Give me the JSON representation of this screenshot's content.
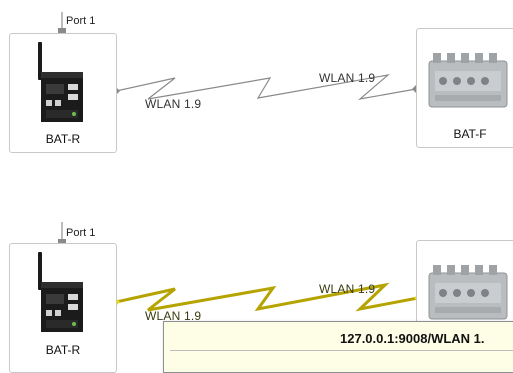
{
  "diagram": {
    "top": {
      "left_device": {
        "label": "BAT-R",
        "port_label": "Port 1"
      },
      "right_device": {
        "label": "BAT-F"
      },
      "link": {
        "label_left": "WLAN 1.9",
        "label_right": "WLAN 1.9",
        "color": "#8a8a8a"
      }
    },
    "bottom": {
      "left_device": {
        "label": "BAT-R",
        "port_label": "Port 1"
      },
      "link": {
        "label_left": "WLAN 1.9",
        "label_right": "WLAN 1.9",
        "color": "#b5a400",
        "selected": true
      }
    }
  },
  "tooltip": {
    "title": "127.0.0.1:9008/WLAN 1."
  }
}
